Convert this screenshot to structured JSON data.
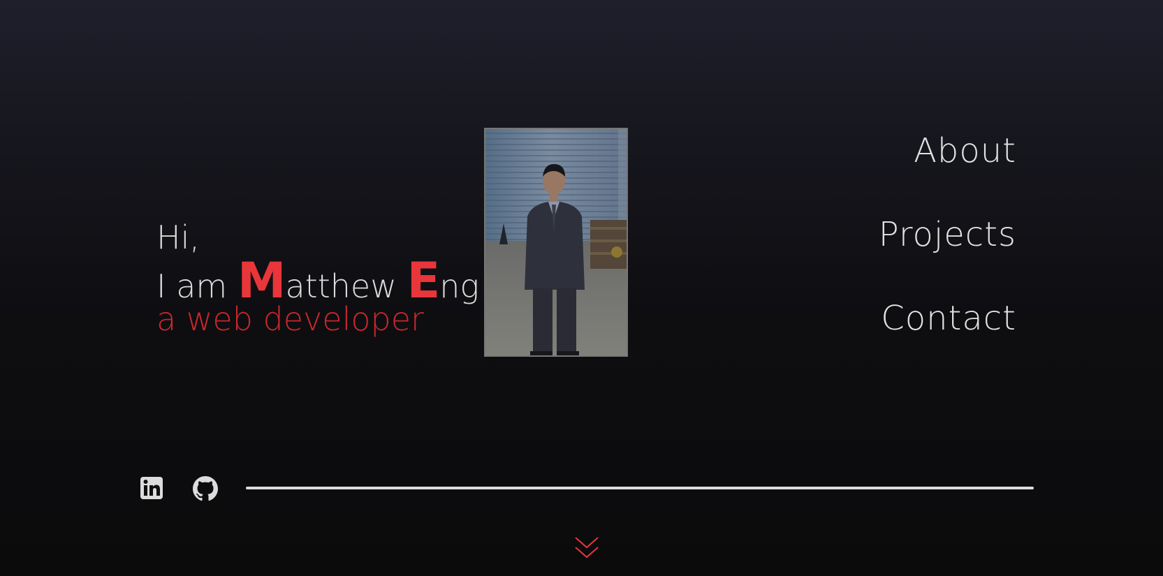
{
  "hero": {
    "greeting": "Hi,",
    "intro_prefix": "I am ",
    "first_initial": "M",
    "first_rest": "atthew ",
    "last_initial": "E",
    "last_rest": "ng",
    "tagline": "a web developer"
  },
  "nav": {
    "items": [
      {
        "label": "About"
      },
      {
        "label": "Projects"
      },
      {
        "label": "Contact"
      }
    ]
  },
  "social": {
    "links": [
      {
        "icon": "linkedin-icon"
      },
      {
        "icon": "github-icon"
      }
    ]
  },
  "scroll": {
    "icon": "chevron-double-down-icon"
  },
  "colors": {
    "accent": "#e8363b",
    "tagline": "#c8282c",
    "text": "#dcdcdc",
    "background_top": "#1f1f2c",
    "background_bottom": "#0b0b0c"
  }
}
